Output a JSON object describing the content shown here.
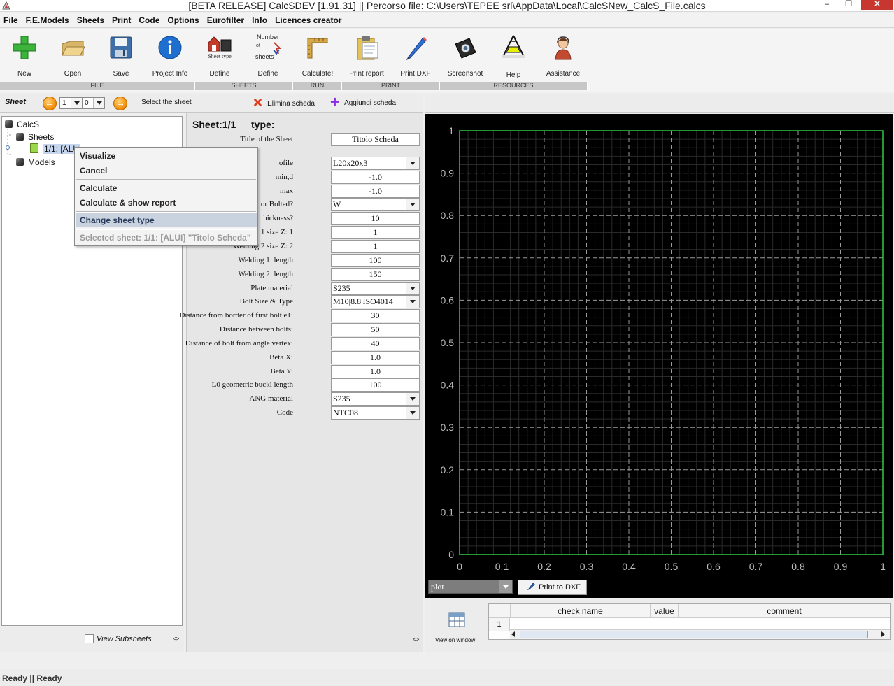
{
  "window": {
    "title": "[BETA RELEASE] CalcSDEV [1.91.31] || Percorso file: C:\\Users\\TEPEE srl\\AppData\\Local\\CalcSNew_CalcS_File.calcs"
  },
  "menu": [
    "File",
    "F.E.Models",
    "Sheets",
    "Print",
    "Code",
    "Options",
    "Eurofilter",
    "Info",
    "Licences creator"
  ],
  "toolbar": {
    "new": "New",
    "open": "Open",
    "save": "Save",
    "project_info": "Project Info",
    "define_type": "Define",
    "define_number": "Define",
    "calculate": "Calculate!",
    "print_report": "Print report",
    "print_dxf": "Print DXF",
    "screenshot": "Screenshot",
    "help": "Help",
    "assistance": "Assistance",
    "sheet_type_icon_text": "Sheet type",
    "number_icon_line1": "Number",
    "number_icon_line2": "of",
    "number_icon_line3": "sheets",
    "groups": {
      "file": "FILE",
      "sheets": "SHEETS",
      "run": "RUN",
      "print": "PRINT",
      "resources": "RESOURCES"
    }
  },
  "sheetbar": {
    "label": "Sheet",
    "spin1": "1",
    "spin2": "0",
    "select_label": "Select the sheet",
    "delete_label": "Elimina scheda",
    "add_label": "Aggiungi scheda"
  },
  "tree": {
    "root": "CalcS",
    "sheets": "Sheets",
    "sheet_item": "1/1: [ALU",
    "models": "Models"
  },
  "context_menu": {
    "visualize": "Visualize",
    "cancel": "Cancel",
    "calculate": "Calculate",
    "calculate_report": "Calculate & show report",
    "change_type": "Change sheet type",
    "selected": "Selected sheet: 1/1: [ALUI] \"Titolo Scheda\""
  },
  "left_bottom": {
    "view_subsheets": "View Subsheets",
    "arrows": "<>"
  },
  "form": {
    "header_sheet": "Sheet:1/1",
    "header_type": "type:",
    "arrows": "<>",
    "rows": [
      {
        "label": "Title of the Sheet",
        "value": "Titolo Scheda",
        "kind": "field"
      },
      {
        "label": "ofile",
        "value": "L20x20x3",
        "kind": "select"
      },
      {
        "label": "min,d",
        "value": "-1.0",
        "kind": "field"
      },
      {
        "label": "max",
        "value": "-1.0",
        "kind": "field"
      },
      {
        "label": "or Bolted?",
        "value": "W",
        "kind": "select"
      },
      {
        "label": "hickness?",
        "value": "10",
        "kind": "field"
      },
      {
        "label": "1 size Z: 1",
        "value": "1",
        "kind": "field"
      },
      {
        "label": "Welding 2 size Z: 2",
        "value": "1",
        "kind": "field"
      },
      {
        "label": "Welding 1: length",
        "value": "100",
        "kind": "field"
      },
      {
        "label": "Welding 2: length",
        "value": "150",
        "kind": "field"
      },
      {
        "label": "Plate material",
        "value": "S235",
        "kind": "select"
      },
      {
        "label": "Bolt Size & Type",
        "value": "M10|8.8|ISO4014",
        "kind": "select"
      },
      {
        "label": "Distance from border of first bolt e1:",
        "value": "30",
        "kind": "field"
      },
      {
        "label": "Distance between bolts:",
        "value": "50",
        "kind": "field"
      },
      {
        "label": "Distance of bolt from angle vertex:",
        "value": "40",
        "kind": "field"
      },
      {
        "label": "Beta X:",
        "value": "1.0",
        "kind": "field"
      },
      {
        "label": "Beta Y:",
        "value": "1.0",
        "kind": "field"
      },
      {
        "label": "L0 geometric buckl length",
        "value": "100",
        "kind": "field"
      },
      {
        "label": "ANG material",
        "value": "S235",
        "kind": "select"
      },
      {
        "label": "Code",
        "value": "NTC08",
        "kind": "select"
      }
    ]
  },
  "plot": {
    "x_ticks": [
      "0",
      "0.1",
      "0.2",
      "0.3",
      "0.4",
      "0.5",
      "0.6",
      "0.7",
      "0.8",
      "0.9",
      "1"
    ],
    "y_ticks": [
      "0",
      "0.1",
      "0.2",
      "0.3",
      "0.4",
      "0.5",
      "0.6",
      "0.7",
      "0.8",
      "0.9",
      "1"
    ],
    "select": "plot",
    "print_dxf": "Print to DXF",
    "frame_color": "#2ecc40"
  },
  "checks": {
    "view_on_window": "View on window",
    "columns": [
      "check name",
      "value",
      "comment"
    ],
    "row_number": "1"
  },
  "status": {
    "text": "Ready || Ready"
  }
}
